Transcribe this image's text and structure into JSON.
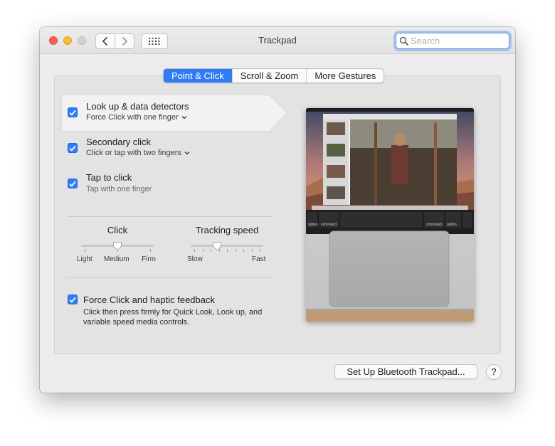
{
  "window": {
    "title": "Trackpad"
  },
  "search": {
    "placeholder": "Search",
    "value": ""
  },
  "tabs": [
    {
      "label": "Point & Click",
      "active": true
    },
    {
      "label": "Scroll & Zoom",
      "active": false
    },
    {
      "label": "More Gestures",
      "active": false
    }
  ],
  "options": [
    {
      "title": "Look up & data detectors",
      "subtitle": "Force Click with one finger",
      "checked": true,
      "has_menu": true,
      "selected": true
    },
    {
      "title": "Secondary click",
      "subtitle": "Click or tap with two fingers",
      "checked": true,
      "has_menu": true,
      "selected": false
    },
    {
      "title": "Tap to click",
      "subtitle": "Tap with one finger",
      "checked": true,
      "has_menu": false,
      "selected": false
    }
  ],
  "click_slider": {
    "label": "Click",
    "tick_labels": [
      "Light",
      "Medium",
      "Firm"
    ],
    "value": "Medium"
  },
  "tracking_slider": {
    "label": "Tracking speed",
    "min_label": "Slow",
    "max_label": "Fast",
    "value_fraction": 0.35
  },
  "force_click": {
    "title": "Force Click and haptic feedback",
    "description": "Click then press firmly for Quick Look, Look up, and variable speed media controls.",
    "checked": true
  },
  "preview": {
    "touchbar_keys": [
      "option",
      "command",
      "command",
      "option"
    ]
  },
  "buttons": {
    "setup_bluetooth": "Set Up Bluetooth Trackpad...",
    "help": "?"
  },
  "colors": {
    "accent": "#2f7cf6",
    "close": "#fd5f57",
    "minimize": "#febc2e"
  }
}
